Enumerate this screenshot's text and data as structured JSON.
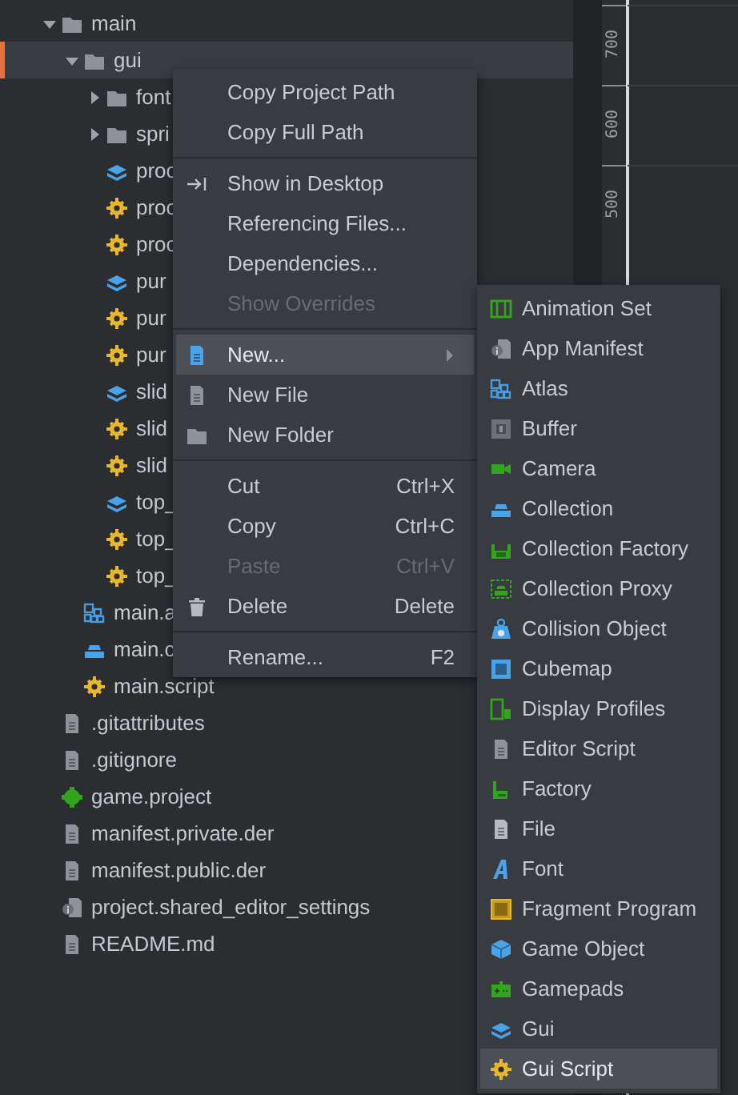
{
  "tree": [
    {
      "label": "main",
      "kind": "folder",
      "expanded": true,
      "selected": false,
      "children": [
        {
          "label": "gui",
          "kind": "folder",
          "expanded": true,
          "selected": true,
          "children": [
            {
              "label": "font",
              "kind": "folder",
              "expanded": false,
              "selected": false
            },
            {
              "label": "spri",
              "kind": "folder",
              "expanded": false,
              "selected": false
            },
            {
              "label": "proc",
              "kind": "gui",
              "selected": false
            },
            {
              "label": "proc",
              "kind": "script",
              "selected": false
            },
            {
              "label": "proc",
              "kind": "script",
              "selected": false
            },
            {
              "label": "pur",
              "kind": "gui",
              "selected": false
            },
            {
              "label": "pur",
              "kind": "script",
              "selected": false
            },
            {
              "label": "pur",
              "kind": "script",
              "selected": false
            },
            {
              "label": "slid",
              "kind": "gui",
              "selected": false
            },
            {
              "label": "slid",
              "kind": "script",
              "selected": false
            },
            {
              "label": "slid",
              "kind": "script",
              "selected": false
            },
            {
              "label": "top_",
              "kind": "gui",
              "selected": false
            },
            {
              "label": "top_",
              "kind": "script",
              "selected": false
            },
            {
              "label": "top_",
              "kind": "script",
              "selected": false
            }
          ]
        },
        {
          "label": "main.a",
          "kind": "atlas",
          "selected": false
        },
        {
          "label": "main.c",
          "kind": "collection",
          "selected": false
        },
        {
          "label": "main.script",
          "kind": "script",
          "selected": false
        }
      ]
    },
    {
      "label": ".gitattributes",
      "kind": "file",
      "selected": false
    },
    {
      "label": ".gitignore",
      "kind": "file",
      "selected": false
    },
    {
      "label": "game.project",
      "kind": "project",
      "selected": false
    },
    {
      "label": "manifest.private.der",
      "kind": "file",
      "selected": false
    },
    {
      "label": "manifest.public.der",
      "kind": "file",
      "selected": false
    },
    {
      "label": "project.shared_editor_settings",
      "kind": "settings",
      "selected": false
    },
    {
      "label": "README.md",
      "kind": "file",
      "selected": false
    }
  ],
  "ruler": [
    "700",
    "600",
    "500"
  ],
  "context_menu": [
    {
      "kind": "text",
      "label": "Copy Project Path",
      "disabled": false,
      "selected": false
    },
    {
      "kind": "text",
      "label": "Copy Full Path",
      "disabled": false,
      "selected": false
    },
    {
      "kind": "separator"
    },
    {
      "kind": "show",
      "label": "Show in Desktop",
      "disabled": false,
      "selected": false
    },
    {
      "kind": "text",
      "label": "Referencing Files...",
      "disabled": false,
      "selected": false
    },
    {
      "kind": "text",
      "label": "Dependencies...",
      "disabled": false,
      "selected": false
    },
    {
      "kind": "text",
      "label": "Show Overrides",
      "disabled": true,
      "selected": false
    },
    {
      "kind": "separator"
    },
    {
      "kind": "newfile",
      "label": "New...",
      "disabled": false,
      "selected": true,
      "submenu": true
    },
    {
      "kind": "file",
      "label": "New File",
      "disabled": false,
      "selected": false
    },
    {
      "kind": "folder",
      "label": "New Folder",
      "disabled": false,
      "selected": false
    },
    {
      "kind": "separator"
    },
    {
      "kind": "text",
      "label": "Cut",
      "shortcut": "Ctrl+X",
      "disabled": false,
      "selected": false
    },
    {
      "kind": "text",
      "label": "Copy",
      "shortcut": "Ctrl+C",
      "disabled": false,
      "selected": false
    },
    {
      "kind": "text",
      "label": "Paste",
      "shortcut": "Ctrl+V",
      "disabled": true,
      "selected": false
    },
    {
      "kind": "trash",
      "label": "Delete",
      "shortcut": "Delete",
      "disabled": false,
      "selected": false
    },
    {
      "kind": "separator"
    },
    {
      "kind": "text",
      "label": "Rename...",
      "shortcut": "F2",
      "disabled": false,
      "selected": false
    }
  ],
  "submenu": [
    {
      "label": "Animation Set",
      "kind": "animset",
      "selected": false
    },
    {
      "label": "App Manifest",
      "kind": "settings",
      "selected": false
    },
    {
      "label": "Atlas",
      "kind": "atlas",
      "selected": false
    },
    {
      "label": "Buffer",
      "kind": "buffer",
      "selected": false
    },
    {
      "label": "Camera",
      "kind": "camera",
      "selected": false
    },
    {
      "label": "Collection",
      "kind": "collection",
      "selected": false
    },
    {
      "label": "Collection Factory",
      "kind": "colfactory",
      "selected": false
    },
    {
      "label": "Collection Proxy",
      "kind": "colproxy",
      "selected": false
    },
    {
      "label": "Collision Object",
      "kind": "collision",
      "selected": false
    },
    {
      "label": "Cubemap",
      "kind": "cubemap",
      "selected": false
    },
    {
      "label": "Display Profiles",
      "kind": "display",
      "selected": false
    },
    {
      "label": "Editor Script",
      "kind": "file",
      "selected": false
    },
    {
      "label": "Factory",
      "kind": "factory",
      "selected": false
    },
    {
      "label": "File",
      "kind": "lightfile",
      "selected": false
    },
    {
      "label": "Font",
      "kind": "font",
      "selected": false
    },
    {
      "label": "Fragment Program",
      "kind": "fragment",
      "selected": false
    },
    {
      "label": "Game Object",
      "kind": "gameobject",
      "selected": false
    },
    {
      "label": "Gamepads",
      "kind": "gamepad",
      "selected": false
    },
    {
      "label": "Gui",
      "kind": "gui",
      "selected": false
    },
    {
      "label": "Gui Script",
      "kind": "script",
      "selected": true
    }
  ]
}
